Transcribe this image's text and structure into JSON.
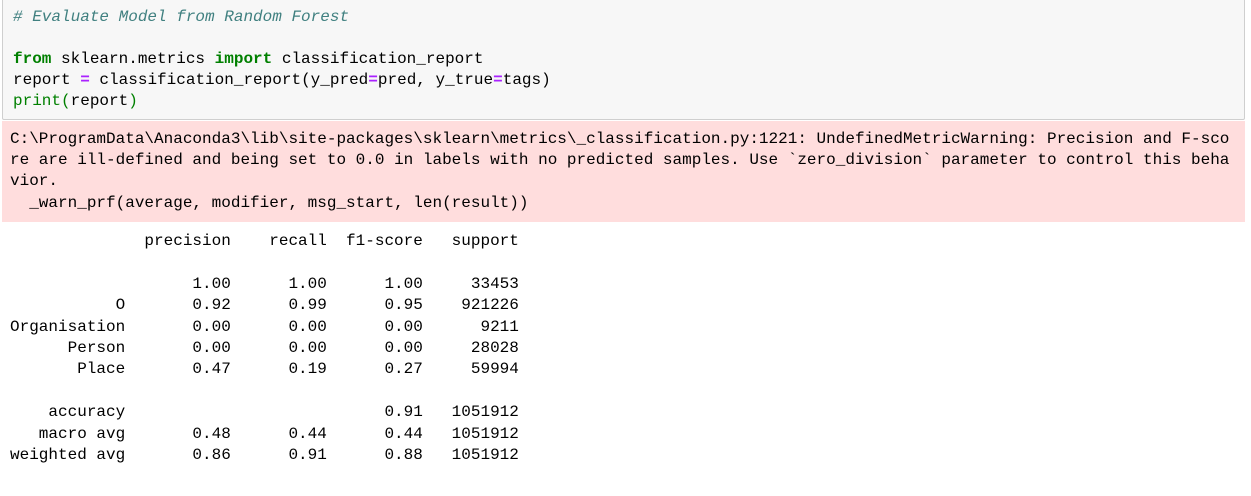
{
  "code": {
    "comment": "# Evaluate Model from Random Forest",
    "line2": {
      "kw1": "from",
      "mod": " sklearn.metrics ",
      "kw2": "import",
      "name": " classification_report"
    },
    "line3": {
      "a": "report ",
      "eq": "=",
      "b": " classification_report(y_pred",
      "eq2": "=",
      "c": "pred, y_true",
      "eq3": "=",
      "d": "tags)"
    },
    "line4": {
      "fn": "print",
      "open": "(",
      "arg": "report",
      "close": ")"
    }
  },
  "stderr": {
    "lines": [
      "C:\\ProgramData\\Anaconda3\\lib\\site-packages\\sklearn\\metrics\\_classification.py:1221: UndefinedMetricWarning: Precision and F-sco",
      "re are ill-defined and being set to 0.0 in labels with no predicted samples. Use `zero_division` parameter to control this beha",
      "vior.",
      "  _warn_prf(average, modifier, msg_start, len(result))"
    ]
  },
  "report": {
    "headers": [
      "precision",
      "recall",
      "f1-score",
      "support"
    ],
    "rows": [
      {
        "label": "",
        "values": [
          "1.00",
          "1.00",
          "1.00",
          "33453"
        ]
      },
      {
        "label": "O",
        "values": [
          "0.92",
          "0.99",
          "0.95",
          "921226"
        ]
      },
      {
        "label": "Organisation",
        "values": [
          "0.00",
          "0.00",
          "0.00",
          "9211"
        ]
      },
      {
        "label": "Person",
        "values": [
          "0.00",
          "0.00",
          "0.00",
          "28028"
        ]
      },
      {
        "label": "Place",
        "values": [
          "0.47",
          "0.19",
          "0.27",
          "59994"
        ]
      }
    ],
    "summary": [
      {
        "label": "accuracy",
        "values": [
          "",
          "",
          "0.91",
          "1051912"
        ]
      },
      {
        "label": "macro avg",
        "values": [
          "0.48",
          "0.44",
          "0.44",
          "1051912"
        ]
      },
      {
        "label": "weighted avg",
        "values": [
          "0.86",
          "0.91",
          "0.88",
          "1051912"
        ]
      }
    ]
  }
}
